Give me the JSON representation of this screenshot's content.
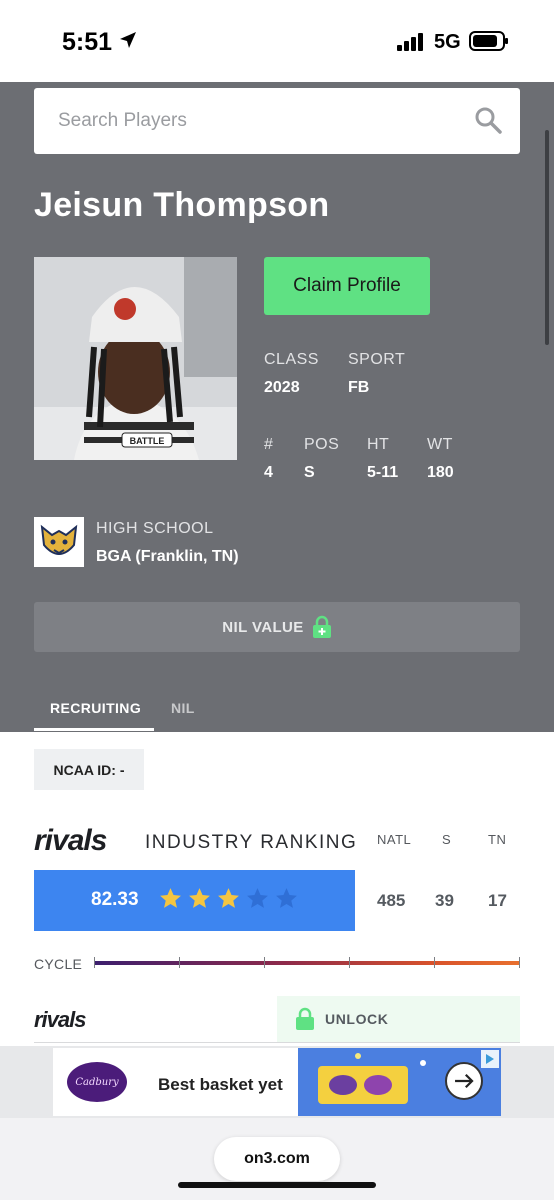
{
  "status_bar": {
    "time": "5:51",
    "network": "5G"
  },
  "search": {
    "placeholder": "Search Players"
  },
  "player": {
    "name": "Jeisun Thompson",
    "claim_label": "Claim Profile",
    "class_label": "CLASS",
    "class_value": "2028",
    "sport_label": "SPORT",
    "sport_value": "FB",
    "number_label": "#",
    "number_value": "4",
    "pos_label": "POS",
    "pos_value": "S",
    "ht_label": "HT",
    "ht_value": "5-11",
    "wt_label": "WT",
    "wt_value": "180",
    "beanie_text": "BATTLE"
  },
  "school": {
    "label": "HIGH SCHOOL",
    "value": "BGA (Franklin, TN)"
  },
  "nil": {
    "label": "NIL VALUE"
  },
  "tabs": [
    {
      "label": "RECRUITING",
      "active": true
    },
    {
      "label": "NIL",
      "active": false
    }
  ],
  "ncaa": {
    "text": "NCAA ID:  -"
  },
  "rankings": {
    "brand": "rivals",
    "title": "INDUSTRY RANKING",
    "columns": [
      "NATL",
      "S",
      "TN"
    ],
    "rating": "82.33",
    "stars_filled": 3,
    "stars_total": 5,
    "values": [
      "485",
      "39",
      "17"
    ],
    "cycle_label": "CYCLE"
  },
  "rivals_section": {
    "brand": "rivals",
    "unlock_label": "UNLOCK"
  },
  "ad": {
    "brand": "Cadbury",
    "text": "Best basket yet"
  },
  "browser": {
    "url": "on3.com"
  },
  "colors": {
    "hero_bg": "#6c6e73",
    "claim_green": "#5fe183",
    "rating_blue": "#3d85f0",
    "star_gold": "#f4c542",
    "lock_green": "#5fe183"
  }
}
